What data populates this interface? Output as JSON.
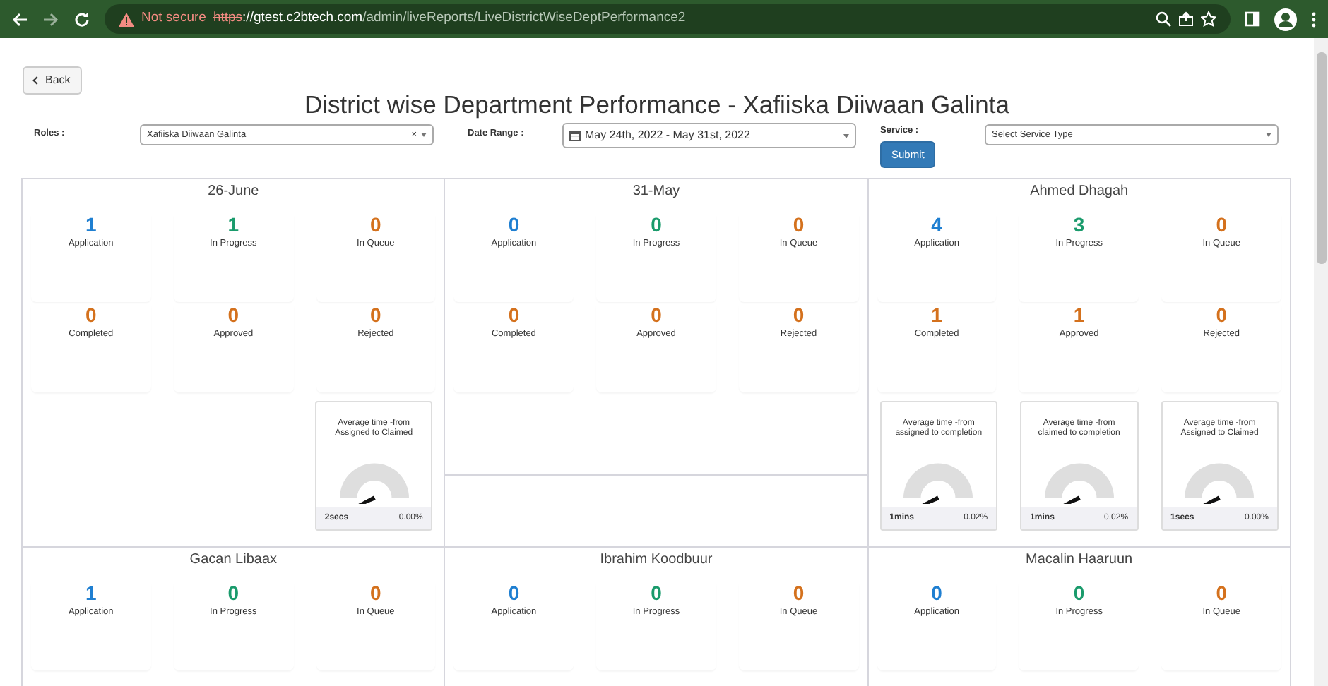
{
  "browser": {
    "security": "Not secure",
    "url_scheme": "https",
    "url_host": "://gtest.c2btech.com",
    "url_path": "/admin/liveReports/LiveDistrictWiseDeptPerformance2"
  },
  "back_button": "Back",
  "title": "District wise Department Performance - Xafiiska Diiwaan Galinta",
  "filters": {
    "roles_label": "Roles :",
    "roles_value": "Xafiiska Diiwaan Galinta",
    "clear": "×",
    "date_label": "Date Range :",
    "date_value": "May 24th, 2022 - May 31st, 2022",
    "service_label": "Service :",
    "service_placeholder": "Select Service Type",
    "submit": "Submit"
  },
  "cards": [
    {
      "name": "26-June",
      "stats": [
        {
          "value": "1",
          "label": "Application",
          "color": "#1f7fd1"
        },
        {
          "value": "1",
          "label": "In Progress",
          "color": "#1a9b6c"
        },
        {
          "value": "0",
          "label": "In Queue",
          "color": "#d4711d"
        },
        {
          "value": "0",
          "label": "Completed",
          "color": "#d4711d"
        },
        {
          "value": "0",
          "label": "Approved",
          "color": "#d4711d"
        },
        {
          "value": "0",
          "label": "Rejected",
          "color": "#d4711d"
        }
      ],
      "gauges": [
        {
          "title": "Average time -from Assigned to Claimed",
          "time": "2secs",
          "percent": "0.00%"
        }
      ]
    },
    {
      "name": "31-May",
      "stats": [
        {
          "value": "0",
          "label": "Application",
          "color": "#1f7fd1"
        },
        {
          "value": "0",
          "label": "In Progress",
          "color": "#1a9b6c"
        },
        {
          "value": "0",
          "label": "In Queue",
          "color": "#d4711d"
        },
        {
          "value": "0",
          "label": "Completed",
          "color": "#d4711d"
        },
        {
          "value": "0",
          "label": "Approved",
          "color": "#d4711d"
        },
        {
          "value": "0",
          "label": "Rejected",
          "color": "#d4711d"
        }
      ]
    },
    {
      "name": "Ahmed Dhagah",
      "stats": [
        {
          "value": "4",
          "label": "Application",
          "color": "#1f7fd1"
        },
        {
          "value": "3",
          "label": "In Progress",
          "color": "#1a9b6c"
        },
        {
          "value": "0",
          "label": "In Queue",
          "color": "#d4711d"
        },
        {
          "value": "1",
          "label": "Completed",
          "color": "#d4711d"
        },
        {
          "value": "1",
          "label": "Approved",
          "color": "#d4711d"
        },
        {
          "value": "0",
          "label": "Rejected",
          "color": "#d4711d"
        }
      ],
      "gauges": [
        {
          "title": "Average time -from assigned to completion",
          "time": "1mins",
          "percent": "0.02%"
        },
        {
          "title": "Average time -from claimed to completion",
          "time": "1mins",
          "percent": "0.02%"
        },
        {
          "title": "Average time -from Assigned to Claimed",
          "time": "1secs",
          "percent": "0.00%"
        }
      ]
    },
    {
      "name": "Gacan Libaax",
      "stats": [
        {
          "value": "1",
          "label": "Application",
          "color": "#1f7fd1"
        },
        {
          "value": "0",
          "label": "In Progress",
          "color": "#1a9b6c"
        },
        {
          "value": "0",
          "label": "In Queue",
          "color": "#d4711d"
        }
      ]
    },
    {
      "name": "Ibrahim Koodbuur",
      "stats": [
        {
          "value": "0",
          "label": "Application",
          "color": "#1f7fd1"
        },
        {
          "value": "0",
          "label": "In Progress",
          "color": "#1a9b6c"
        },
        {
          "value": "0",
          "label": "In Queue",
          "color": "#d4711d"
        }
      ]
    },
    {
      "name": "Macalin Haaruun",
      "stats": [
        {
          "value": "0",
          "label": "Application",
          "color": "#1f7fd1"
        },
        {
          "value": "0",
          "label": "In Progress",
          "color": "#1a9b6c"
        },
        {
          "value": "0",
          "label": "In Queue",
          "color": "#d4711d"
        }
      ]
    }
  ]
}
